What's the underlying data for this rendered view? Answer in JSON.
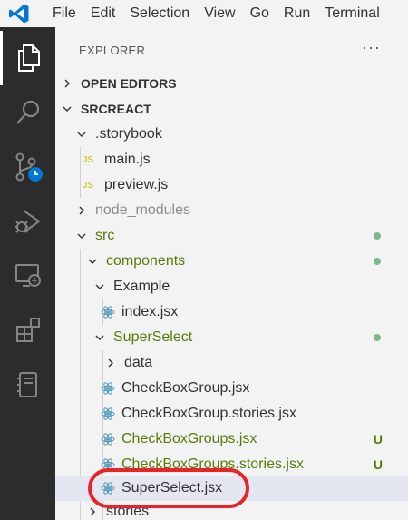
{
  "menubar": {
    "items": [
      "File",
      "Edit",
      "Selection",
      "View",
      "Go",
      "Run",
      "Terminal"
    ]
  },
  "activity_bar": {
    "icons": [
      "files-icon",
      "search-icon",
      "source-control-icon",
      "run-debug-icon",
      "remote-explorer-icon",
      "extensions-icon",
      "notebook-icon"
    ]
  },
  "explorer": {
    "title": "EXPLORER",
    "more": "···",
    "open_editors": "OPEN EDITORS",
    "root": "SRCREACT",
    "tree": [
      {
        "label": ".storybook",
        "kind": "folder-open",
        "color": "normal"
      },
      {
        "label": "main.js",
        "kind": "js",
        "color": "normal"
      },
      {
        "label": "preview.js",
        "kind": "js",
        "color": "normal"
      },
      {
        "label": "node_modules",
        "kind": "folder-closed",
        "color": "gray"
      },
      {
        "label": "src",
        "kind": "folder-open",
        "color": "green",
        "badge": "dot"
      },
      {
        "label": "components",
        "kind": "folder-open",
        "color": "green",
        "badge": "dot"
      },
      {
        "label": "Example",
        "kind": "folder-open",
        "color": "normal"
      },
      {
        "label": "index.jsx",
        "kind": "react",
        "color": "normal"
      },
      {
        "label": "SuperSelect",
        "kind": "folder-open",
        "color": "green",
        "badge": "dot"
      },
      {
        "label": "data",
        "kind": "folder-closed",
        "color": "normal"
      },
      {
        "label": "CheckBoxGroup.jsx",
        "kind": "react",
        "color": "normal"
      },
      {
        "label": "CheckBoxGroup.stories.jsx",
        "kind": "react",
        "color": "normal"
      },
      {
        "label": "CheckBoxGroups.jsx",
        "kind": "react",
        "color": "green",
        "badge": "U"
      },
      {
        "label": "CheckBoxGroups.stories.jsx",
        "kind": "react",
        "color": "green",
        "badge": "U"
      },
      {
        "label": "SuperSelect.jsx",
        "kind": "react",
        "color": "normal",
        "selected": true
      },
      {
        "label": "stories",
        "kind": "folder-closed",
        "color": "normal"
      }
    ],
    "js_badge": "JS",
    "untracked_badge": "U"
  },
  "colors": {
    "accent_green": "#587c0c",
    "git_dot": "#81b88b",
    "annotation_red": "#e8232a",
    "activity_bar_bg": "#2c2c2c"
  }
}
